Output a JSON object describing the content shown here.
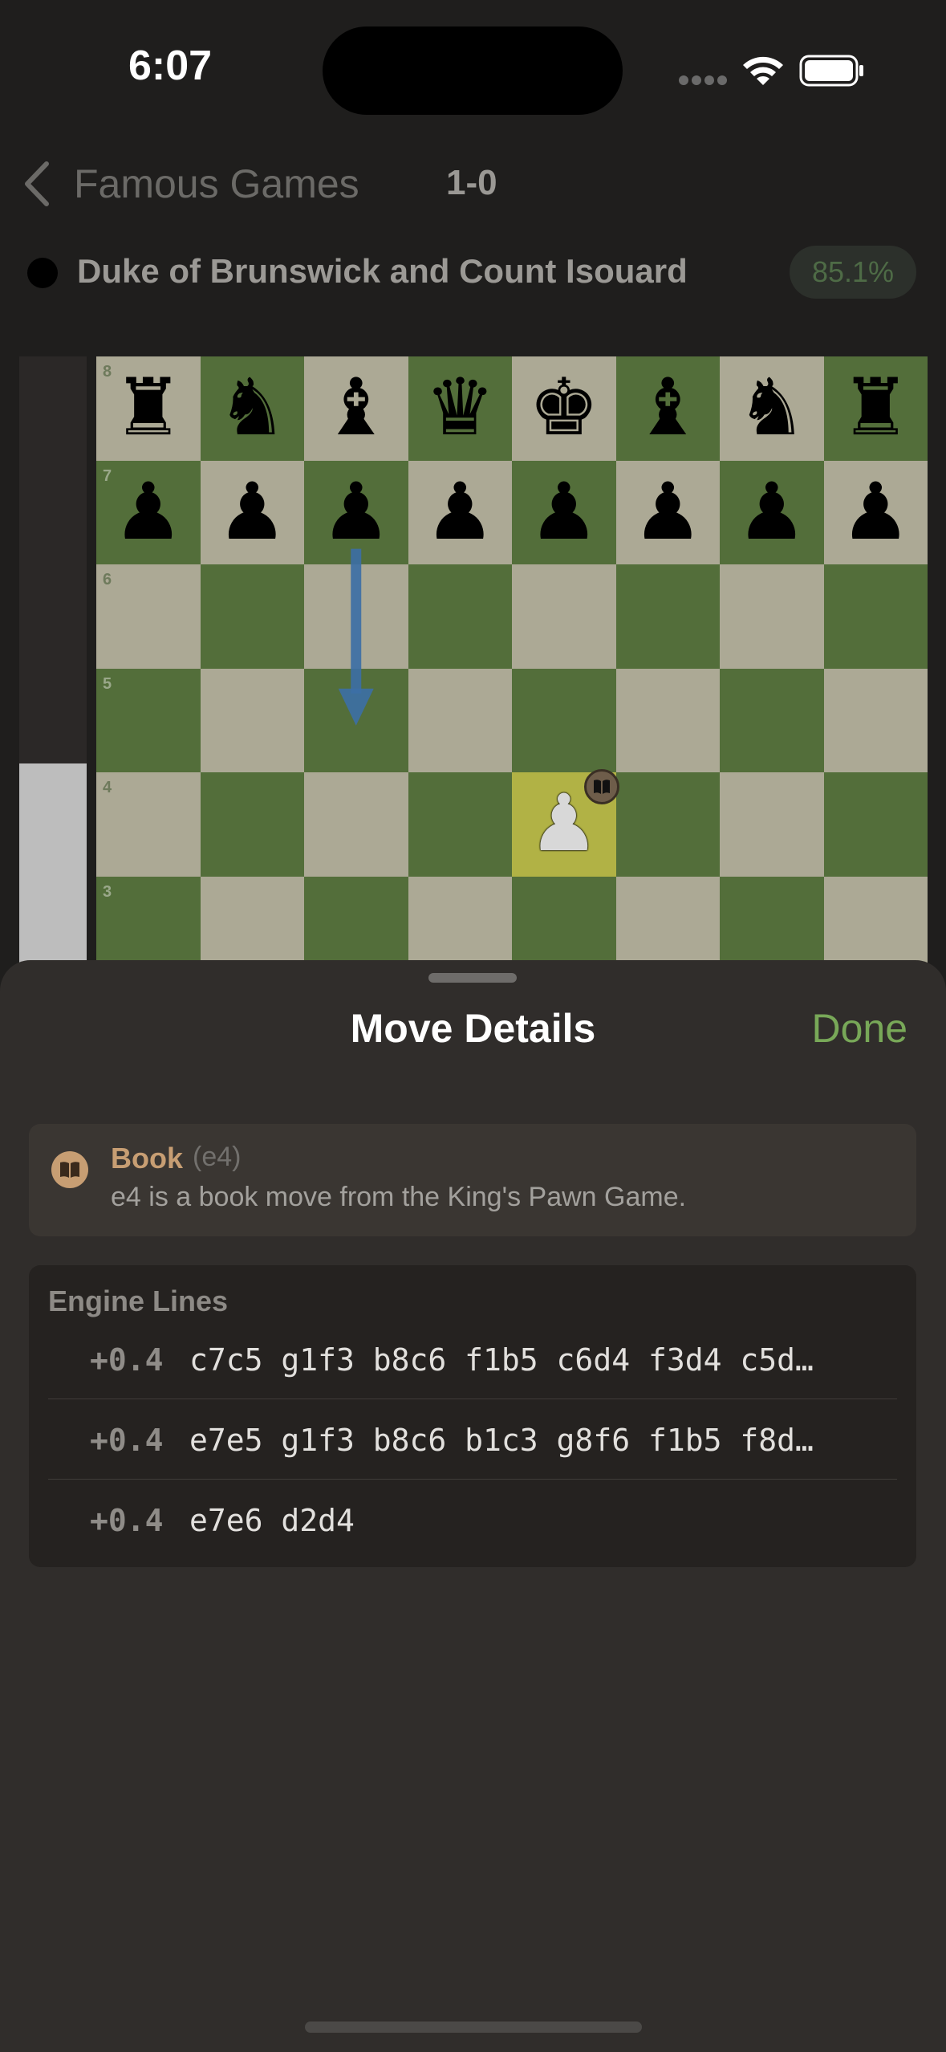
{
  "status_bar": {
    "time": "6:07"
  },
  "nav": {
    "back_label": "Famous Games",
    "result": "1-0"
  },
  "player": {
    "name": "Duke of Brunswick and Count Isouard",
    "accuracy": "85.1%"
  },
  "evaluation": {
    "white_share": 0.33
  },
  "board": {
    "visible_ranks": [
      "8",
      "7",
      "6",
      "5",
      "4",
      "3"
    ],
    "pieces": [
      {
        "square": "a8",
        "glyph": "♜",
        "color": "black",
        "name": "black-rook"
      },
      {
        "square": "b8",
        "glyph": "♞",
        "color": "black",
        "name": "black-knight"
      },
      {
        "square": "c8",
        "glyph": "♝",
        "color": "black",
        "name": "black-bishop"
      },
      {
        "square": "d8",
        "glyph": "♛",
        "color": "black",
        "name": "black-queen"
      },
      {
        "square": "e8",
        "glyph": "♚",
        "color": "black",
        "name": "black-king"
      },
      {
        "square": "f8",
        "glyph": "♝",
        "color": "black",
        "name": "black-bishop"
      },
      {
        "square": "g8",
        "glyph": "♞",
        "color": "black",
        "name": "black-knight"
      },
      {
        "square": "h8",
        "glyph": "♜",
        "color": "black",
        "name": "black-rook"
      },
      {
        "square": "a7",
        "glyph": "♟",
        "color": "black",
        "name": "black-pawn"
      },
      {
        "square": "b7",
        "glyph": "♟",
        "color": "black",
        "name": "black-pawn"
      },
      {
        "square": "c7",
        "glyph": "♟",
        "color": "black",
        "name": "black-pawn"
      },
      {
        "square": "d7",
        "glyph": "♟",
        "color": "black",
        "name": "black-pawn"
      },
      {
        "square": "e7",
        "glyph": "♟",
        "color": "black",
        "name": "black-pawn"
      },
      {
        "square": "f7",
        "glyph": "♟",
        "color": "black",
        "name": "black-pawn"
      },
      {
        "square": "g7",
        "glyph": "♟",
        "color": "black",
        "name": "black-pawn"
      },
      {
        "square": "h7",
        "glyph": "♟",
        "color": "black",
        "name": "black-pawn"
      },
      {
        "square": "e4",
        "glyph": "♟",
        "color": "white",
        "name": "white-pawn"
      }
    ],
    "highlight_square": "e4",
    "arrow": {
      "from": "c7",
      "to": "c5"
    },
    "colors": {
      "light": "#aca995",
      "dark": "#536e3a",
      "highlight": "#b1b245",
      "arrow": "#3c6fa6"
    }
  },
  "sheet": {
    "title": "Move Details",
    "done_label": "Done",
    "book": {
      "title": "Book",
      "move": "(e4)",
      "description": "e4 is a book move from the King's Pawn Game."
    },
    "engine": {
      "heading": "Engine Lines",
      "lines": [
        {
          "score": "+0.4",
          "moves": "c7c5 g1f3 b8c6 f1b5 c6d4 f3d4 c5d…"
        },
        {
          "score": "+0.4",
          "moves": "e7e5 g1f3 b8c6 b1c3 g8f6 f1b5 f8d…"
        },
        {
          "score": "+0.4",
          "moves": "e7e6 d2d4"
        }
      ]
    }
  },
  "colors": {
    "accent": "#78a858",
    "book": "#c79e73",
    "sheet_bg": "#302d2b"
  }
}
